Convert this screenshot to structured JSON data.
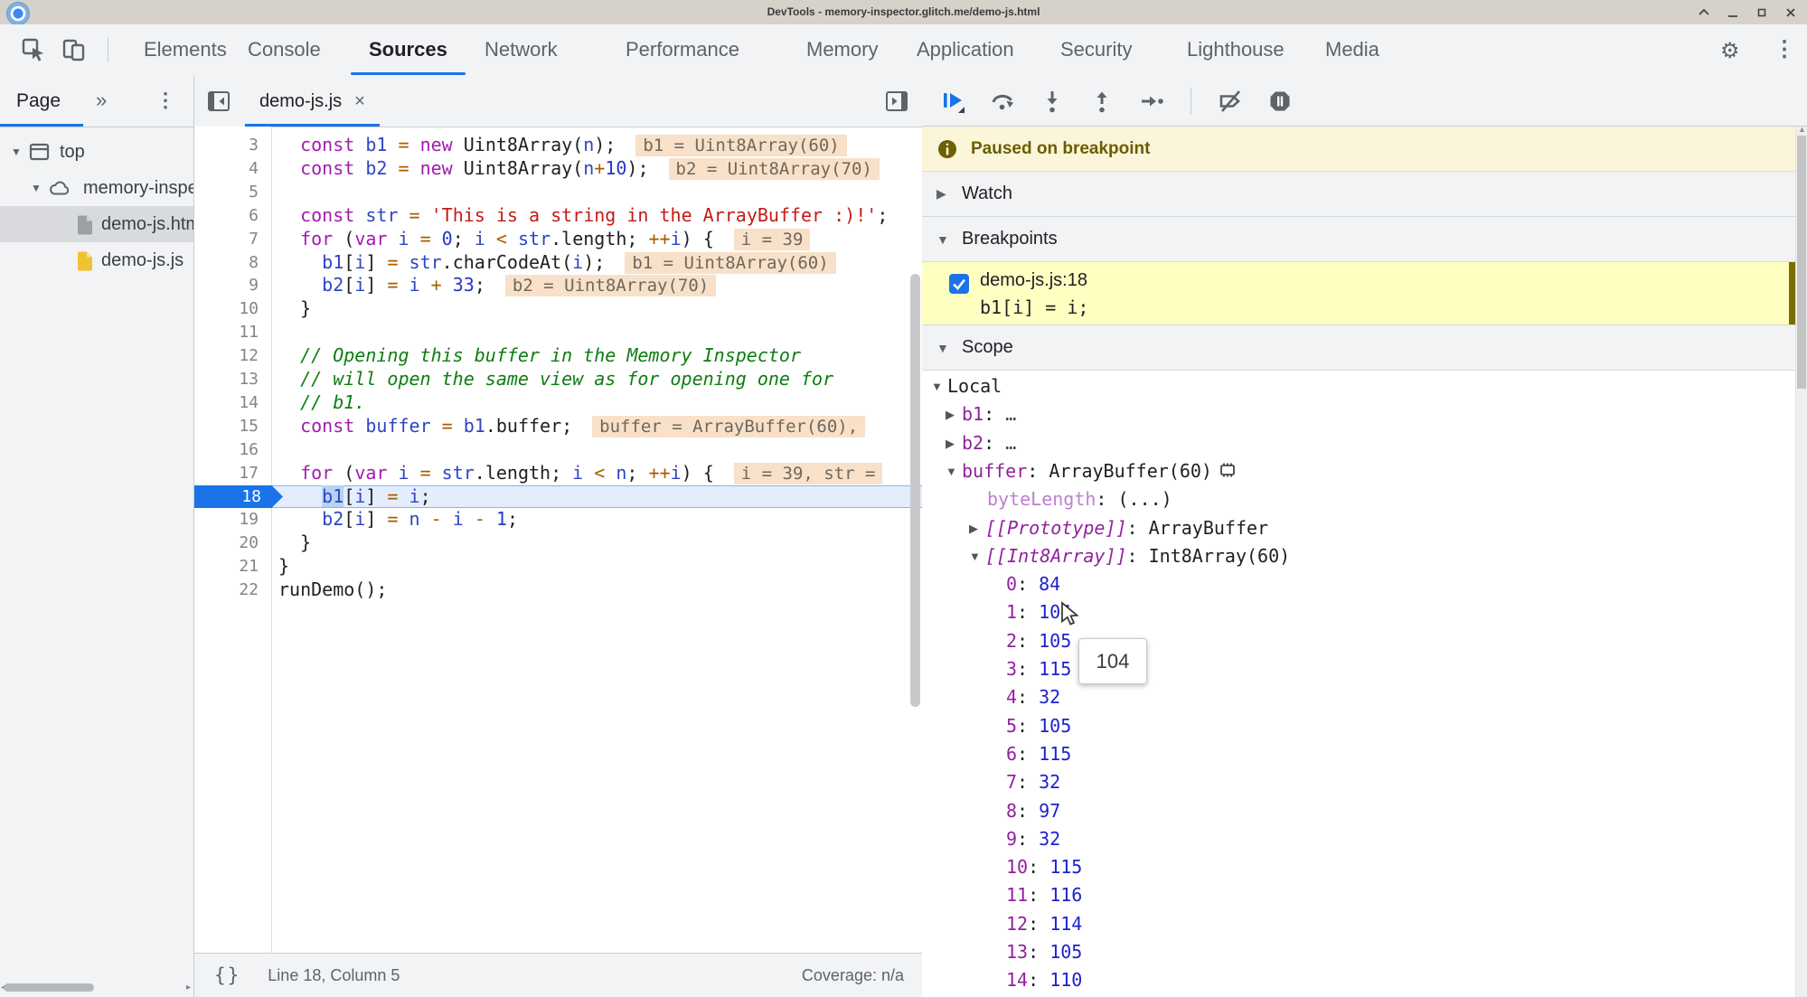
{
  "window": {
    "title": "DevTools - memory-inspector.glitch.me/demo-js.html",
    "controls": [
      "restore-icon",
      "minimize-icon",
      "maximize-icon",
      "close-icon"
    ]
  },
  "devtools": {
    "tabs": [
      "Elements",
      "Console",
      "Sources",
      "Network",
      "Performance",
      "Memory",
      "Application",
      "Security",
      "Lighthouse",
      "Media"
    ],
    "active_tab": "Sources",
    "left_icons": [
      "inspect-icon",
      "device-toolbar-icon"
    ],
    "right_icons": [
      "gear-icon",
      "kebab-icon"
    ]
  },
  "sidebar": {
    "tab": "Page",
    "more_tabs_icon": "chevrons-icon",
    "menu_icon": "kebab-icon",
    "tree": [
      {
        "label": "top",
        "icon": "frame-icon",
        "depth": 0,
        "expanded": true,
        "selected": false
      },
      {
        "label": "memory-inspector.glitch.me",
        "icon": "cloud-icon",
        "depth": 1,
        "expanded": true,
        "selected": false
      },
      {
        "label": "demo-js.html",
        "icon": "file-icon-gray",
        "depth": 2,
        "selected": true
      },
      {
        "label": "demo-js.js",
        "icon": "file-icon-yellow",
        "depth": 2,
        "selected": false
      }
    ]
  },
  "editor": {
    "tab_label": "demo-js.js",
    "close_icon": "close-icon",
    "status": {
      "line_col": "Line 18, Column 5",
      "coverage": "Coverage: n/a"
    },
    "lines": [
      {
        "n": 3,
        "tokens": [
          [
            "pl",
            "  "
          ],
          [
            "kw",
            "const"
          ],
          [
            "pl",
            " "
          ],
          [
            "vr",
            "b1"
          ],
          [
            "pl",
            " "
          ],
          [
            "op",
            "="
          ],
          [
            "pl",
            " "
          ],
          [
            "kw",
            "new"
          ],
          [
            "pl",
            " Uint8Array("
          ],
          [
            "vr",
            "n"
          ],
          [
            "pl",
            ");"
          ]
        ],
        "hint": "b1 = Uint8Array(60)"
      },
      {
        "n": 4,
        "tokens": [
          [
            "pl",
            "  "
          ],
          [
            "kw",
            "const"
          ],
          [
            "pl",
            " "
          ],
          [
            "vr",
            "b2"
          ],
          [
            "pl",
            " "
          ],
          [
            "op",
            "="
          ],
          [
            "pl",
            " "
          ],
          [
            "kw",
            "new"
          ],
          [
            "pl",
            " Uint8Array("
          ],
          [
            "vr",
            "n"
          ],
          [
            "op",
            "+"
          ],
          [
            "nu",
            "10"
          ],
          [
            "pl",
            ");"
          ]
        ],
        "hint": "b2 = Uint8Array(70)"
      },
      {
        "n": 5,
        "tokens": []
      },
      {
        "n": 6,
        "tokens": [
          [
            "pl",
            "  "
          ],
          [
            "kw",
            "const"
          ],
          [
            "pl",
            " "
          ],
          [
            "vr",
            "str"
          ],
          [
            "pl",
            " "
          ],
          [
            "op",
            "="
          ],
          [
            "pl",
            " "
          ],
          [
            "st",
            "'This is a string in the ArrayBuffer :)!'"
          ],
          [
            "pl",
            ";"
          ]
        ]
      },
      {
        "n": 7,
        "tokens": [
          [
            "pl",
            "  "
          ],
          [
            "kw",
            "for"
          ],
          [
            "pl",
            " ("
          ],
          [
            "kw",
            "var"
          ],
          [
            "pl",
            " "
          ],
          [
            "vr",
            "i"
          ],
          [
            "pl",
            " "
          ],
          [
            "op",
            "="
          ],
          [
            "pl",
            " "
          ],
          [
            "nu",
            "0"
          ],
          [
            "pl",
            "; "
          ],
          [
            "vr",
            "i"
          ],
          [
            "pl",
            " "
          ],
          [
            "op",
            "<"
          ],
          [
            "pl",
            " "
          ],
          [
            "vr",
            "str"
          ],
          [
            "pl",
            ".length; "
          ],
          [
            "op",
            "++"
          ],
          [
            "vr",
            "i"
          ],
          [
            "pl",
            ") {"
          ]
        ],
        "hint": "i = 39"
      },
      {
        "n": 8,
        "tokens": [
          [
            "pl",
            "    "
          ],
          [
            "vr",
            "b1"
          ],
          [
            "pl",
            "["
          ],
          [
            "vr",
            "i"
          ],
          [
            "pl",
            "] "
          ],
          [
            "op",
            "="
          ],
          [
            "pl",
            " "
          ],
          [
            "vr",
            "str"
          ],
          [
            "pl",
            ".charCodeAt("
          ],
          [
            "vr",
            "i"
          ],
          [
            "pl",
            ");"
          ]
        ],
        "hint": "b1 = Uint8Array(60)"
      },
      {
        "n": 9,
        "tokens": [
          [
            "pl",
            "    "
          ],
          [
            "vr",
            "b2"
          ],
          [
            "pl",
            "["
          ],
          [
            "vr",
            "i"
          ],
          [
            "pl",
            "] "
          ],
          [
            "op",
            "="
          ],
          [
            "pl",
            " "
          ],
          [
            "vr",
            "i"
          ],
          [
            "pl",
            " "
          ],
          [
            "op",
            "+"
          ],
          [
            "pl",
            " "
          ],
          [
            "nu",
            "33"
          ],
          [
            "pl",
            ";"
          ]
        ],
        "hint": "b2 = Uint8Array(70)"
      },
      {
        "n": 10,
        "tokens": [
          [
            "pl",
            "  }"
          ]
        ]
      },
      {
        "n": 11,
        "tokens": []
      },
      {
        "n": 12,
        "tokens": [
          [
            "pl",
            "  "
          ],
          [
            "cm",
            "// Opening this buffer in the Memory Inspector"
          ]
        ]
      },
      {
        "n": 13,
        "tokens": [
          [
            "pl",
            "  "
          ],
          [
            "cm",
            "// will open the same view as for opening one for"
          ]
        ]
      },
      {
        "n": 14,
        "tokens": [
          [
            "pl",
            "  "
          ],
          [
            "cm",
            "// b1."
          ]
        ]
      },
      {
        "n": 15,
        "tokens": [
          [
            "pl",
            "  "
          ],
          [
            "kw",
            "const"
          ],
          [
            "pl",
            " "
          ],
          [
            "vr",
            "buffer"
          ],
          [
            "pl",
            " "
          ],
          [
            "op",
            "="
          ],
          [
            "pl",
            " "
          ],
          [
            "vr",
            "b1"
          ],
          [
            "pl",
            ".buffer;"
          ]
        ],
        "hint": "buffer = ArrayBuffer(60),"
      },
      {
        "n": 16,
        "tokens": []
      },
      {
        "n": 17,
        "tokens": [
          [
            "pl",
            "  "
          ],
          [
            "kw",
            "for"
          ],
          [
            "pl",
            " ("
          ],
          [
            "kw",
            "var"
          ],
          [
            "pl",
            " "
          ],
          [
            "vr",
            "i"
          ],
          [
            "pl",
            " "
          ],
          [
            "op",
            "="
          ],
          [
            "pl",
            " "
          ],
          [
            "vr",
            "str"
          ],
          [
            "pl",
            ".length; "
          ],
          [
            "vr",
            "i"
          ],
          [
            "pl",
            " "
          ],
          [
            "op",
            "<"
          ],
          [
            "pl",
            " "
          ],
          [
            "vr",
            "n"
          ],
          [
            "pl",
            "; "
          ],
          [
            "op",
            "++"
          ],
          [
            "vr",
            "i"
          ],
          [
            "pl",
            ") {"
          ]
        ],
        "hint": "i = 39, str ="
      },
      {
        "n": 18,
        "current": true,
        "tokens": [
          [
            "pl",
            "    "
          ],
          [
            "sel",
            "b1"
          ],
          [
            "pl",
            "["
          ],
          [
            "vr",
            "i"
          ],
          [
            "pl",
            "] "
          ],
          [
            "op",
            "="
          ],
          [
            "pl",
            " "
          ],
          [
            "vr",
            "i"
          ],
          [
            "pl",
            ";"
          ]
        ]
      },
      {
        "n": 19,
        "tokens": [
          [
            "pl",
            "    "
          ],
          [
            "vr",
            "b2"
          ],
          [
            "pl",
            "["
          ],
          [
            "vr",
            "i"
          ],
          [
            "pl",
            "] "
          ],
          [
            "op",
            "="
          ],
          [
            "pl",
            " "
          ],
          [
            "vr",
            "n"
          ],
          [
            "pl",
            " "
          ],
          [
            "op",
            "-"
          ],
          [
            "pl",
            " "
          ],
          [
            "vr",
            "i"
          ],
          [
            "pl",
            " "
          ],
          [
            "op",
            "-"
          ],
          [
            "pl",
            " "
          ],
          [
            "nu",
            "1"
          ],
          [
            "pl",
            ";"
          ]
        ]
      },
      {
        "n": 20,
        "tokens": [
          [
            "pl",
            "  }"
          ]
        ]
      },
      {
        "n": 21,
        "tokens": [
          [
            "pl",
            "}"
          ]
        ]
      },
      {
        "n": 22,
        "tokens": [
          [
            "pl",
            "runDemo();"
          ]
        ]
      }
    ]
  },
  "debugger": {
    "toolbar": [
      "resume-icon",
      "step-over-icon",
      "step-into-icon",
      "step-out-icon",
      "step-icon",
      "separator",
      "deactivate-breakpoints-icon",
      "pause-exceptions-icon"
    ],
    "paused_message": "Paused on breakpoint",
    "paused_icon": "info-icon",
    "sections": {
      "watch": "Watch",
      "breakpoints": "Breakpoints",
      "scope": "Scope"
    },
    "breakpoint": {
      "checked": true,
      "location": "demo-js.js:18",
      "code": "b1[i] = i;"
    },
    "scope_rows": [
      {
        "e": "open",
        "d": 1,
        "n": "Local",
        "nc": "plain"
      },
      {
        "e": "closed",
        "d": 2,
        "n": "b1",
        "nc": "pname",
        "v": "…",
        "vc": "dim"
      },
      {
        "e": "closed",
        "d": 2,
        "n": "b2",
        "nc": "pname",
        "v": "…",
        "vc": "dim"
      },
      {
        "e": "open",
        "d": 2,
        "n": "buffer",
        "nc": "pname",
        "v": "ArrayBuffer(60)",
        "vc": "vdark",
        "icon": "memory-inspector-icon"
      },
      {
        "e": "none",
        "d": 3,
        "n": "byteLength",
        "nc": "pfaded",
        "v": "(...)",
        "vc": "vdark"
      },
      {
        "e": "closed",
        "d": 3,
        "n": "[[Prototype]]",
        "nc": "pinternal",
        "v": "ArrayBuffer",
        "vc": "vdark"
      },
      {
        "e": "open",
        "d": 3,
        "n": "[[Int8Array]]",
        "nc": "pinternal",
        "v": "Int8Array(60)",
        "vc": "vdark"
      },
      {
        "e": "none",
        "d": 4,
        "n": "0",
        "nc": "pname",
        "v": "84",
        "vc": "vnum"
      },
      {
        "e": "none",
        "d": 4,
        "n": "1",
        "nc": "pname",
        "v": "104",
        "vc": "vnum"
      },
      {
        "e": "none",
        "d": 4,
        "n": "2",
        "nc": "pname",
        "v": "105",
        "vc": "vnum"
      },
      {
        "e": "none",
        "d": 4,
        "n": "3",
        "nc": "pname",
        "v": "115",
        "vc": "vnum"
      },
      {
        "e": "none",
        "d": 4,
        "n": "4",
        "nc": "pname",
        "v": "32",
        "vc": "vnum"
      },
      {
        "e": "none",
        "d": 4,
        "n": "5",
        "nc": "pname",
        "v": "105",
        "vc": "vnum"
      },
      {
        "e": "none",
        "d": 4,
        "n": "6",
        "nc": "pname",
        "v": "115",
        "vc": "vnum"
      },
      {
        "e": "none",
        "d": 4,
        "n": "7",
        "nc": "pname",
        "v": "32",
        "vc": "vnum"
      },
      {
        "e": "none",
        "d": 4,
        "n": "8",
        "nc": "pname",
        "v": "97",
        "vc": "vnum"
      },
      {
        "e": "none",
        "d": 4,
        "n": "9",
        "nc": "pname",
        "v": "32",
        "vc": "vnum"
      },
      {
        "e": "none",
        "d": 4,
        "n": "10",
        "nc": "pname",
        "v": "115",
        "vc": "vnum"
      },
      {
        "e": "none",
        "d": 4,
        "n": "11",
        "nc": "pname",
        "v": "116",
        "vc": "vnum"
      },
      {
        "e": "none",
        "d": 4,
        "n": "12",
        "nc": "pname",
        "v": "114",
        "vc": "vnum"
      },
      {
        "e": "none",
        "d": 4,
        "n": "13",
        "nc": "pname",
        "v": "105",
        "vc": "vnum"
      },
      {
        "e": "none",
        "d": 4,
        "n": "14",
        "nc": "pname",
        "v": "110",
        "vc": "vnum"
      }
    ],
    "tooltip": "104"
  },
  "colors": {
    "accent": "#1a73e8",
    "titlebar_bg": "#d6d2ca",
    "toolbar_bg": "#f1f3f4",
    "paused_banner_bg": "#fbf5da",
    "paused_banner_text": "#6a5d00",
    "breakpoint_row_bg": "#ffffc2",
    "execution_line_bg": "#e4edfc",
    "inline_hint_bg": "#f8e1c8",
    "token_keyword": "#a21caf",
    "token_variable": "#2f45c5",
    "token_string": "#c41a16",
    "token_comment": "#0c7d10",
    "token_operator": "#aa5b00",
    "scope_property": "#92219e",
    "scope_number": "#1c22cf"
  }
}
